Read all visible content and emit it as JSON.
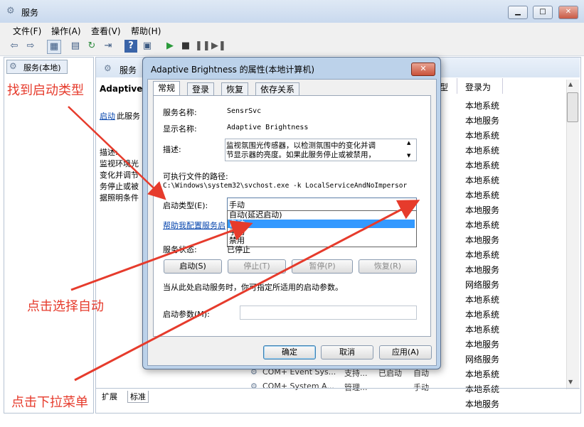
{
  "window": {
    "title": "服务",
    "controls": [
      "minimize",
      "maximize",
      "close"
    ]
  },
  "menubar": [
    "文件(F)",
    "操作(A)",
    "查看(V)",
    "帮助(H)"
  ],
  "toolbar": {
    "icons": [
      "back-icon",
      "forward-icon",
      "show-tree-icon",
      "properties-icon",
      "refresh-icon",
      "export-icon",
      "help-icon",
      "console-icon",
      "start-icon",
      "stop-icon",
      "pause-icon",
      "restart-icon"
    ]
  },
  "tree": {
    "root_label": "服务(本地)"
  },
  "pane": {
    "header": "服务",
    "service_name_partial": "Adaptive",
    "start_link": "启动",
    "start_link_suffix": "此服务",
    "desc_label": "描述:",
    "desc_partial": [
      "监视环境光",
      "变化并调节",
      "务停止或被",
      "据照明条件"
    ],
    "col_partial": "型",
    "col_logon": "登录为",
    "logon_values": [
      "本地系统",
      "本地服务",
      "本地系统",
      "本地系统",
      "本地系统",
      "本地系统",
      "本地系统",
      "本地服务",
      "本地系统",
      "本地服务",
      "本地系统",
      "本地服务",
      "网络服务",
      "本地系统",
      "本地系统",
      "本地系统",
      "本地服务",
      "网络服务",
      "本地系统",
      "本地系统",
      "本地服务"
    ],
    "rows_bottom": [
      {
        "name": "COM+ Event Sys...",
        "desc": "支持...",
        "status": "已启动",
        "startup": "自动"
      },
      {
        "name": "COM+ System A...",
        "desc": "管理...",
        "status": "",
        "startup": "手动"
      }
    ],
    "bottom_tabs": [
      "扩展",
      "标准"
    ]
  },
  "dialog": {
    "title": "Adaptive Brightness 的属性(本地计算机)",
    "close_label": "✕",
    "tabs": [
      "常规",
      "登录",
      "恢复",
      "依存关系"
    ],
    "service_name_label": "服务名称:",
    "service_name_value": "SensrSvc",
    "display_name_label": "显示名称:",
    "display_name_value": "Adaptive Brightness",
    "description_label": "描述:",
    "description_lines": [
      "监视氛围光传感器，以检测氛围中的变化并调",
      "节显示器的亮度。如果此服务停止或被禁用，"
    ],
    "exe_path_label": "可执行文件的路径:",
    "exe_path_value": "C:\\Windows\\system32\\svchost.exe -k LocalServiceAndNoImpersor",
    "startup_type_label": "启动类型(E):",
    "startup_type_value": "手动",
    "startup_options": [
      "自动(延迟启动)",
      "自动",
      "手动",
      "禁用"
    ],
    "selected_option_index": 1,
    "help_link": "帮助我配置服务启",
    "status_label": "服务状态:",
    "status_value": "已停止",
    "buttons_service": [
      "启动(S)",
      "停止(T)",
      "暂停(P)",
      "恢复(R)"
    ],
    "hint_text": "当从此处启动服务时，你可指定所适用的启动参数。",
    "param_label": "启动参数(M):",
    "buttons_footer": [
      "确定",
      "取消",
      "应用(A)"
    ]
  },
  "annotations": {
    "find_startup_type": "找到启动类型",
    "click_select_auto": "点击选择自动",
    "click_dropdown": "点击下拉菜单"
  },
  "colors": {
    "annotation_red": "#e63b2c",
    "selection_blue": "#3399ff"
  }
}
